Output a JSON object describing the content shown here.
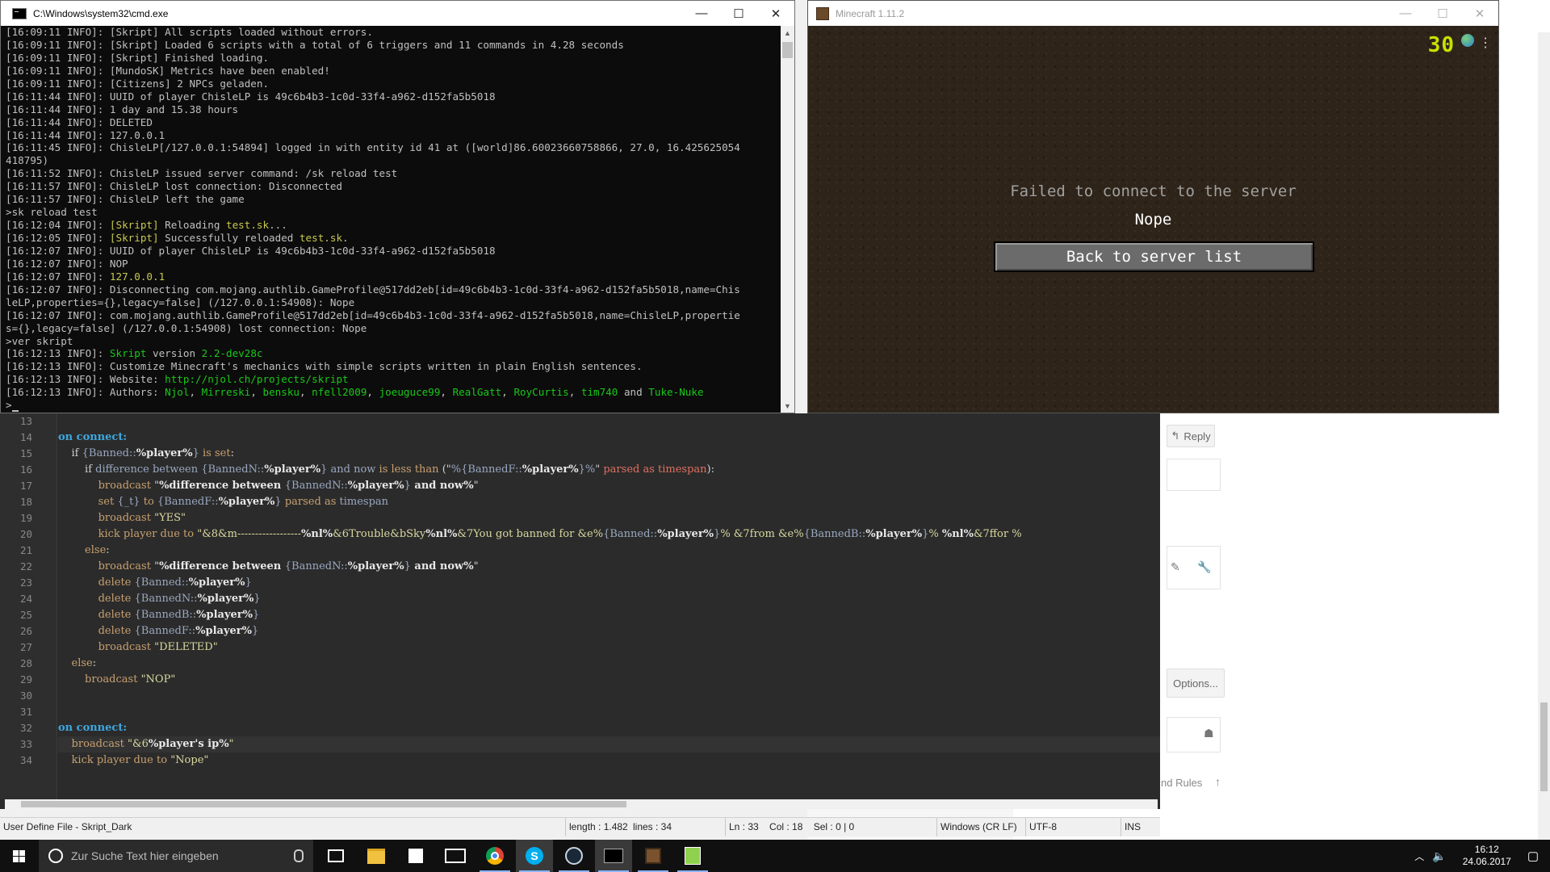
{
  "cmd": {
    "title": "C:\\Windows\\system32\\cmd.exe",
    "lines": [
      [
        {
          "t": "[16:09:11 INFO]: [Skript] All scripts loaded without errors."
        }
      ],
      [
        {
          "t": "[16:09:11 INFO]: [Skript] Loaded 6 scripts with a total of 6 triggers and 11 commands in 4.28 seconds"
        }
      ],
      [
        {
          "t": "[16:09:11 INFO]: [Skript] Finished loading."
        }
      ],
      [
        {
          "t": "[16:09:11 INFO]: [MundoSK] Metrics have been enabled!"
        }
      ],
      [
        {
          "t": "[16:09:11 INFO]: [Citizens] 2 NPCs geladen."
        }
      ],
      [
        {
          "t": "[16:11:44 INFO]: UUID of player ChisleLP is 49c6b4b3-1c0d-33f4-a962-d152fa5b5018"
        }
      ],
      [
        {
          "t": "[16:11:44 INFO]: 1 day and 15.38 hours"
        }
      ],
      [
        {
          "t": "[16:11:44 INFO]: DELETED"
        }
      ],
      [
        {
          "t": "[16:11:44 INFO]: 127.0.0.1"
        }
      ],
      [
        {
          "t": "[16:11:45 INFO]: ChisleLP[/127.0.0.1:54894] logged in with entity id 41 at ([world]86.60023660758866, 27.0, 16.425625054"
        }
      ],
      [
        {
          "t": "418795)"
        }
      ],
      [
        {
          "t": "[16:11:52 INFO]: ChisleLP issued server command: /sk reload test"
        }
      ],
      [
        {
          "t": "[16:11:57 INFO]: ChisleLP lost connection: Disconnected"
        }
      ],
      [
        {
          "t": "[16:11:57 INFO]: ChisleLP left the game"
        }
      ],
      [
        {
          "t": ">sk reload test"
        }
      ],
      [
        {
          "t": "[16:12:04 INFO]: "
        },
        {
          "t": "[Skript]",
          "c": "y"
        },
        {
          "t": " Reloading "
        },
        {
          "t": "test.sk",
          "c": "y"
        },
        {
          "t": "..."
        }
      ],
      [
        {
          "t": "[16:12:05 INFO]: "
        },
        {
          "t": "[Skript]",
          "c": "y"
        },
        {
          "t": " Successfully reloaded "
        },
        {
          "t": "test.sk",
          "c": "y"
        },
        {
          "t": "."
        }
      ],
      [
        {
          "t": "[16:12:07 INFO]: UUID of player ChisleLP is 49c6b4b3-1c0d-33f4-a962-d152fa5b5018"
        }
      ],
      [
        {
          "t": "[16:12:07 INFO]: NOP"
        }
      ],
      [
        {
          "t": "[16:12:07 INFO]: "
        },
        {
          "t": "127.0.0.1",
          "c": "y"
        }
      ],
      [
        {
          "t": "[16:12:07 INFO]: Disconnecting com.mojang.authlib.GameProfile@517dd2eb[id=49c6b4b3-1c0d-33f4-a962-d152fa5b5018,name=Chis"
        }
      ],
      [
        {
          "t": "leLP,properties={},legacy=false] (/127.0.0.1:54908): Nope"
        }
      ],
      [
        {
          "t": "[16:12:07 INFO]: com.mojang.authlib.GameProfile@517dd2eb[id=49c6b4b3-1c0d-33f4-a962-d152fa5b5018,name=ChisleLP,propertie"
        }
      ],
      [
        {
          "t": "s={},legacy=false] (/127.0.0.1:54908) lost connection: Nope"
        }
      ],
      [
        {
          "t": ">ver skript"
        }
      ],
      [
        {
          "t": "[16:12:13 INFO]: "
        },
        {
          "t": "Skript",
          "c": "g"
        },
        {
          "t": " version "
        },
        {
          "t": "2.2-dev28c",
          "c": "g"
        }
      ],
      [
        {
          "t": "[16:12:13 INFO]: Customize Minecraft's mechanics with simple scripts written in plain English sentences."
        }
      ],
      [
        {
          "t": "[16:12:13 INFO]: Website: "
        },
        {
          "t": "http://njol.ch/projects/skript",
          "c": "g"
        }
      ],
      [
        {
          "t": "[16:12:13 INFO]: Authors: "
        },
        {
          "t": "Njol",
          "c": "g"
        },
        {
          "t": ", "
        },
        {
          "t": "Mirreski",
          "c": "g"
        },
        {
          "t": ", "
        },
        {
          "t": "bensku",
          "c": "g"
        },
        {
          "t": ", "
        },
        {
          "t": "nfell2009",
          "c": "g"
        },
        {
          "t": ", "
        },
        {
          "t": "joeuguce99",
          "c": "g"
        },
        {
          "t": ", "
        },
        {
          "t": "RealGatt",
          "c": "g"
        },
        {
          "t": ", "
        },
        {
          "t": "RoyCurtis",
          "c": "g"
        },
        {
          "t": ", "
        },
        {
          "t": "tim740",
          "c": "g"
        },
        {
          "t": " and "
        },
        {
          "t": "Tuke-Nuke",
          "c": "g"
        }
      ],
      [
        {
          "t": ">"
        }
      ]
    ]
  },
  "minecraft": {
    "title": "Minecraft 1.11.2",
    "fps": "30",
    "error_title": "Failed to connect to the server",
    "reason": "Nope",
    "back_button": "Back to server list"
  },
  "editor": {
    "lines": [
      {
        "n": "13",
        "s": []
      },
      {
        "n": "14",
        "s": [
          {
            "t": "on connect:",
            "c": "kw-blue"
          }
        ]
      },
      {
        "n": "15",
        "s": [
          {
            "t": "    if "
          },
          {
            "t": "{Banned::",
            "c": "kw-var"
          },
          {
            "t": "%player%",
            "c": "kw-bold"
          },
          {
            "t": "}",
            "c": "kw-var"
          },
          {
            "t": " is set",
            "c": "kw-fn"
          },
          {
            "t": ":"
          }
        ]
      },
      {
        "n": "16",
        "s": [
          {
            "t": "        if "
          },
          {
            "t": "difference between ",
            "c": "kw-var"
          },
          {
            "t": "{BannedN::",
            "c": "kw-var"
          },
          {
            "t": "%player%",
            "c": "kw-bold"
          },
          {
            "t": "}",
            "c": "kw-var"
          },
          {
            "t": " and now ",
            "c": "kw-var"
          },
          {
            "t": "is less than",
            "c": "kw-fn"
          },
          {
            "t": " (\""
          },
          {
            "t": "%{BannedF::",
            "c": "kw-var"
          },
          {
            "t": "%player%",
            "c": "kw-bold"
          },
          {
            "t": "}%",
            "c": "kw-var"
          },
          {
            "t": "\" "
          },
          {
            "t": "parsed as timespan",
            "c": "kw-red"
          },
          {
            "t": "):"
          }
        ]
      },
      {
        "n": "17",
        "s": [
          {
            "t": "            broadcast ",
            "c": "kw-fn"
          },
          {
            "t": "\""
          },
          {
            "t": "%difference between ",
            "c": "kw-bold"
          },
          {
            "t": "{BannedN::",
            "c": "kw-var"
          },
          {
            "t": "%player%",
            "c": "kw-bold"
          },
          {
            "t": "}",
            "c": "kw-var"
          },
          {
            "t": " and now%",
            "c": "kw-bold"
          },
          {
            "t": "\""
          }
        ]
      },
      {
        "n": "18",
        "s": [
          {
            "t": "            set ",
            "c": "kw-fn"
          },
          {
            "t": "{_t}",
            "c": "kw-var"
          },
          {
            "t": " to ",
            "c": "kw-fn"
          },
          {
            "t": "{BannedF::",
            "c": "kw-var"
          },
          {
            "t": "%player%",
            "c": "kw-bold"
          },
          {
            "t": "}",
            "c": "kw-var"
          },
          {
            "t": " parsed as ",
            "c": "kw-fn"
          },
          {
            "t": "timespan",
            "c": "kw-var"
          }
        ]
      },
      {
        "n": "19",
        "s": [
          {
            "t": "            broadcast ",
            "c": "kw-fn"
          },
          {
            "t": "\"YES\"",
            "c": "kw-str"
          }
        ]
      },
      {
        "n": "20",
        "s": [
          {
            "t": "            kick player due to ",
            "c": "kw-fn"
          },
          {
            "t": "\"&8&m------------------",
            "c": "kw-str"
          },
          {
            "t": "%nl%",
            "c": "kw-bold"
          },
          {
            "t": "&6Trouble&bSky",
            "c": "kw-str"
          },
          {
            "t": "%nl%",
            "c": "kw-bold"
          },
          {
            "t": "&7You got banned for &e%",
            "c": "kw-str"
          },
          {
            "t": "{Banned::",
            "c": "kw-var"
          },
          {
            "t": "%player%",
            "c": "kw-bold"
          },
          {
            "t": "}",
            "c": "kw-var"
          },
          {
            "t": "% &7from &e%",
            "c": "kw-str"
          },
          {
            "t": "{BannedB::",
            "c": "kw-var"
          },
          {
            "t": "%player%",
            "c": "kw-bold"
          },
          {
            "t": "}",
            "c": "kw-var"
          },
          {
            "t": "% ",
            "c": "kw-str"
          },
          {
            "t": "%nl%",
            "c": "kw-bold"
          },
          {
            "t": "&7ffor %",
            "c": "kw-str"
          }
        ]
      },
      {
        "n": "21",
        "s": [
          {
            "t": "        else",
            "c": "kw-fn"
          },
          {
            "t": ":"
          }
        ]
      },
      {
        "n": "22",
        "s": [
          {
            "t": "            broadcast ",
            "c": "kw-fn"
          },
          {
            "t": "\""
          },
          {
            "t": "%difference between ",
            "c": "kw-bold"
          },
          {
            "t": "{BannedN::",
            "c": "kw-var"
          },
          {
            "t": "%player%",
            "c": "kw-bold"
          },
          {
            "t": "}",
            "c": "kw-var"
          },
          {
            "t": " and now%",
            "c": "kw-bold"
          },
          {
            "t": "\""
          }
        ]
      },
      {
        "n": "23",
        "s": [
          {
            "t": "            delete ",
            "c": "kw-fn"
          },
          {
            "t": "{Banned::",
            "c": "kw-var"
          },
          {
            "t": "%player%",
            "c": "kw-bold"
          },
          {
            "t": "}",
            "c": "kw-var"
          }
        ]
      },
      {
        "n": "24",
        "s": [
          {
            "t": "            delete ",
            "c": "kw-fn"
          },
          {
            "t": "{BannedN::",
            "c": "kw-var"
          },
          {
            "t": "%player%",
            "c": "kw-bold"
          },
          {
            "t": "}",
            "c": "kw-var"
          }
        ]
      },
      {
        "n": "25",
        "s": [
          {
            "t": "            delete ",
            "c": "kw-fn"
          },
          {
            "t": "{BannedB::",
            "c": "kw-var"
          },
          {
            "t": "%player%",
            "c": "kw-bold"
          },
          {
            "t": "}",
            "c": "kw-var"
          }
        ]
      },
      {
        "n": "26",
        "s": [
          {
            "t": "            delete ",
            "c": "kw-fn"
          },
          {
            "t": "{BannedF::",
            "c": "kw-var"
          },
          {
            "t": "%player%",
            "c": "kw-bold"
          },
          {
            "t": "}",
            "c": "kw-var"
          }
        ]
      },
      {
        "n": "27",
        "s": [
          {
            "t": "            broadcast ",
            "c": "kw-fn"
          },
          {
            "t": "\"DELETED\"",
            "c": "kw-str"
          }
        ]
      },
      {
        "n": "28",
        "s": [
          {
            "t": "    else",
            "c": "kw-fn"
          },
          {
            "t": ":"
          }
        ]
      },
      {
        "n": "29",
        "s": [
          {
            "t": "        broadcast ",
            "c": "kw-fn"
          },
          {
            "t": "\"NOP\"",
            "c": "kw-str"
          }
        ]
      },
      {
        "n": "30",
        "s": []
      },
      {
        "n": "31",
        "s": []
      },
      {
        "n": "32",
        "s": [
          {
            "t": "on connect:",
            "c": "kw-blue"
          }
        ]
      },
      {
        "n": "33",
        "s": [
          {
            "t": "    broadcast ",
            "c": "kw-fn"
          },
          {
            "t": "\"&6",
            "c": "kw-str"
          },
          {
            "t": "%player's ip%",
            "c": "kw-bold"
          },
          {
            "t": "\"",
            "c": "kw-str"
          }
        ],
        "hl": true
      },
      {
        "n": "34",
        "s": [
          {
            "t": "    kick player due to ",
            "c": "kw-fn"
          },
          {
            "t": "\"Nope\"",
            "c": "kw-str"
          }
        ]
      }
    ]
  },
  "statusbar": {
    "language": "User Define File - Skript_Dark",
    "length": "length : 1.482",
    "lines": "lines : 34",
    "position": "Ln : 33    Col : 18    Sel : 0 | 0",
    "eol": "Windows (CR LF)",
    "encoding": "UTF-8",
    "mode": "INS"
  },
  "browser": {
    "reply": "Reply",
    "options": "Options...",
    "rules": "nd Rules"
  },
  "taskbar": {
    "search_placeholder": "Zur Suche Text hier eingeben",
    "time": "16:12",
    "date": "24.06.2017"
  }
}
